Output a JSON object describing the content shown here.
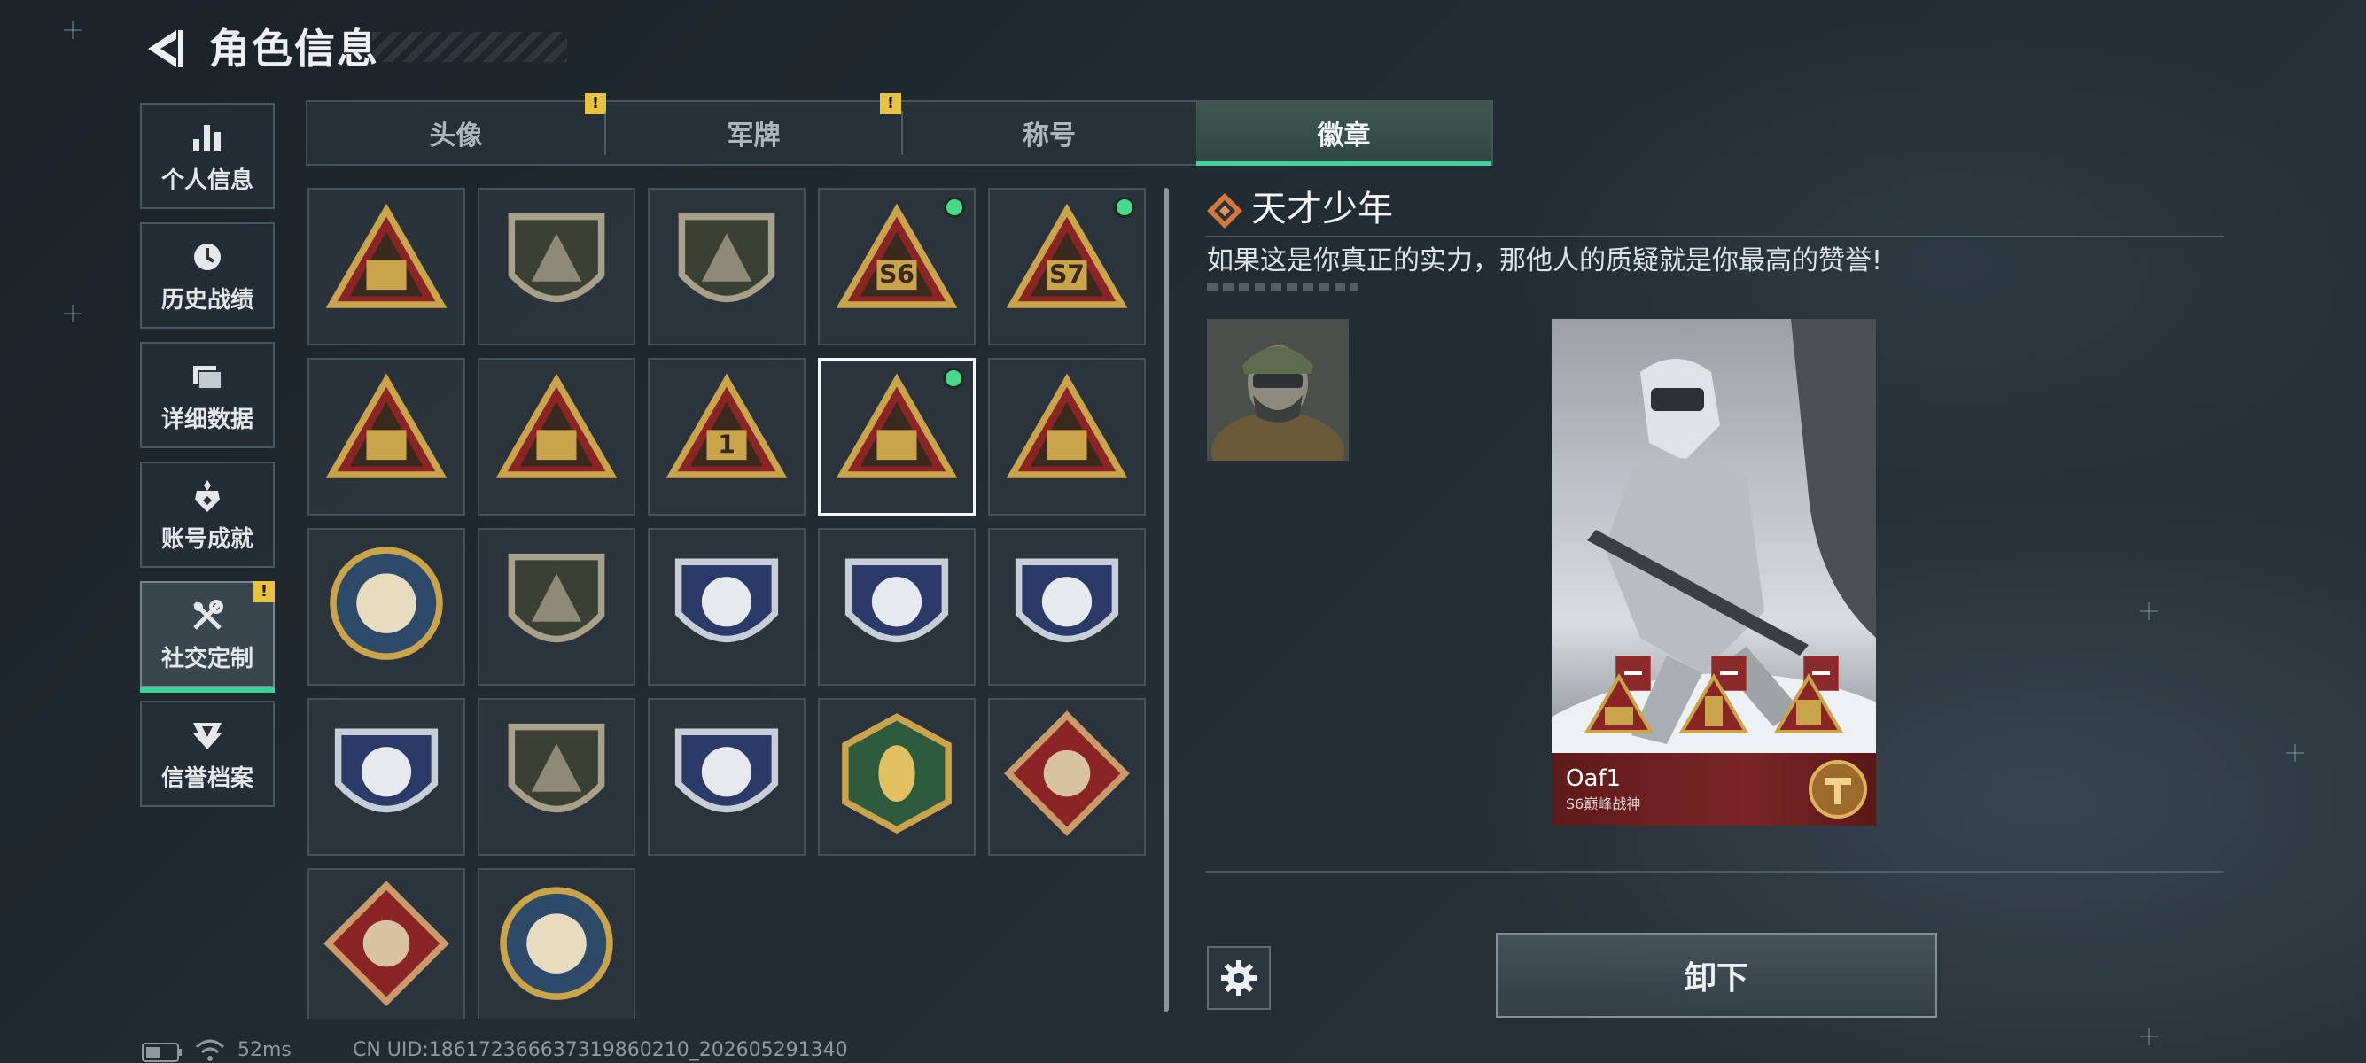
{
  "header": {
    "title": "角色信息"
  },
  "sidebar": {
    "items": [
      {
        "label": "个人信息",
        "icon": "bar-chart-icon"
      },
      {
        "label": "历史战绩",
        "icon": "history-clock-icon"
      },
      {
        "label": "详细数据",
        "icon": "folder-icon"
      },
      {
        "label": "账号成就",
        "icon": "achievement-icon"
      },
      {
        "label": "社交定制",
        "icon": "tools-icon",
        "active": true,
        "alert": "!"
      },
      {
        "label": "信誉档案",
        "icon": "reputation-icon"
      }
    ]
  },
  "tabs": [
    {
      "label": "头像",
      "alert": "!"
    },
    {
      "label": "军牌",
      "alert": "!"
    },
    {
      "label": "称号"
    },
    {
      "label": "徽章",
      "active": true
    }
  ],
  "badges": [
    {
      "icon": "triangle-shield-badge-icon"
    },
    {
      "icon": "helicopter-shield-badge-icon"
    },
    {
      "icon": "dagger-shield-badge-icon"
    },
    {
      "icon": "s6-triangle-badge-icon",
      "equipped": true,
      "text": "S6"
    },
    {
      "icon": "s7-triangle-badge-icon",
      "equipped": true,
      "text": "S7"
    },
    {
      "icon": "bird-triangle-badge-icon"
    },
    {
      "icon": "tank-triangle-badge-icon"
    },
    {
      "icon": "number-one-triangle-badge-icon",
      "text": "1"
    },
    {
      "icon": "tower-triangle-badge-icon",
      "equipped": true,
      "selected": true
    },
    {
      "icon": "soldiers-triangle-badge-icon"
    },
    {
      "icon": "star-circle-badge-icon"
    },
    {
      "icon": "emblem-shield-badge-icon"
    },
    {
      "icon": "stars-crest-badge-icon"
    },
    {
      "icon": "diamond-crest-badge-icon"
    },
    {
      "icon": "skull-crest-badge-icon"
    },
    {
      "icon": "sniper-crest-badge-icon"
    },
    {
      "icon": "rifle-shield-badge-icon"
    },
    {
      "icon": "crosshair-crest-badge-icon"
    },
    {
      "icon": "hornet-hexagon-badge-icon"
    },
    {
      "icon": "dragon-diamond-badge-icon"
    },
    {
      "icon": "runner-diamond-badge-icon"
    },
    {
      "icon": "lynx-circle-badge-icon"
    }
  ],
  "detail": {
    "title": "天才少年",
    "description": "如果这是你真正的实力，那他人的质疑就是你最高的赞誉!",
    "card": {
      "name": "Oaf1",
      "subtitle": "S6巅峰战神"
    }
  },
  "actions": {
    "unequip_label": "卸下"
  },
  "status_bar": {
    "ping": "52ms",
    "uid": "CN UID:18617236663731986021​0_202605291340"
  },
  "colors": {
    "accent_green": "#3dd195",
    "alert_yellow": "#e9c340",
    "card_red": "#7a2525",
    "badge_gold": "#c9a44a",
    "badge_red": "#8b2424"
  }
}
